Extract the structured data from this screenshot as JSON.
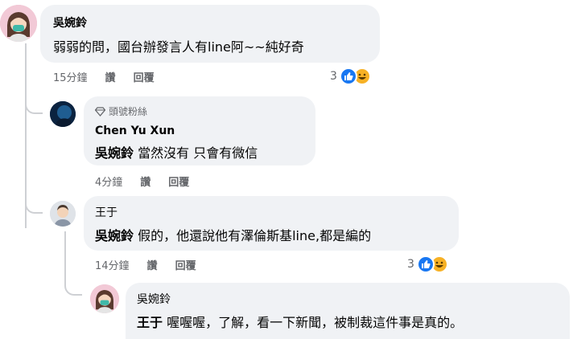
{
  "comments": [
    {
      "author": "吳婉鈴",
      "text": "弱弱的問，國台辦發言人有line阿~~純好奇",
      "time": "15分鐘",
      "like_label": "讚",
      "reply_label": "回覆",
      "reactions": "3",
      "reaction_icons": [
        "like-icon",
        "haha-icon"
      ]
    },
    {
      "badge": "頭號粉絲",
      "badge_icon": "diamond-icon",
      "author": "Chen Yu Xun",
      "mention": "吳婉鈴",
      "text": "當然沒有 只會有微信",
      "time": "4分鐘",
      "like_label": "讚",
      "reply_label": "回覆"
    },
    {
      "author": "王于",
      "mention": "吳婉鈴",
      "text": "假的，他還說他有澤倫斯基line,都是編的",
      "time": "14分鐘",
      "like_label": "讚",
      "reply_label": "回覆",
      "reactions": "3",
      "reaction_icons": [
        "like-icon",
        "haha-icon"
      ]
    },
    {
      "author": "吳婉鈴",
      "mention": "王于",
      "text": "喔喔喔，了解，看一下新聞，被制裁這件事是真的。"
    }
  ],
  "colors": {
    "bubble": "#f0f2f5",
    "meta_text": "#65676b",
    "like_blue": "#1877f2",
    "haha_yellow": "#f7b125",
    "thread_line": "#ced0d4"
  }
}
